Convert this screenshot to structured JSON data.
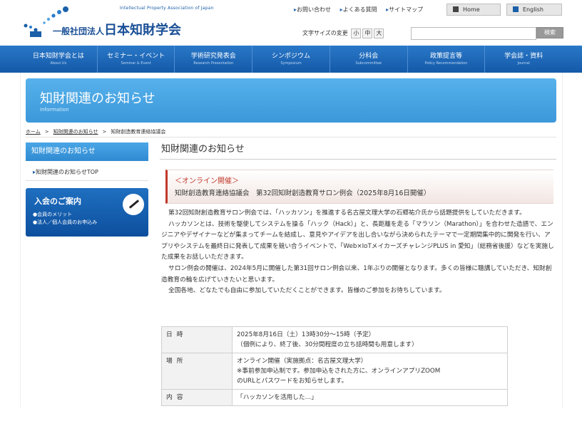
{
  "header": {
    "logo_en": "Intellectual Property Association of Japan",
    "logo_prefix": "一般社団法人",
    "logo_name": "日本知財学会",
    "top_links": [
      "お問い合わせ",
      "よくある質問",
      "サイトマップ"
    ],
    "home_button": "Home",
    "english_button": "English",
    "font_size_label": "文字サイズの変更",
    "font_sizes": [
      "小",
      "中",
      "大"
    ],
    "search_placeholder": "",
    "search_button": "検索"
  },
  "nav": [
    {
      "label": "日本知財学会とは",
      "en": "About Us"
    },
    {
      "label": "セミナー・イベント",
      "en": "Seminar & Event"
    },
    {
      "label": "学術研究発表会",
      "en": "Research Presentation"
    },
    {
      "label": "シンポジウム",
      "en": "Symposium"
    },
    {
      "label": "分科会",
      "en": "Subcommittee"
    },
    {
      "label": "政策提言等",
      "en": "Policy Recommendation"
    },
    {
      "label": "学会誌・資料",
      "en": "Journal"
    }
  ],
  "banner": {
    "title": "知財関連のお知らせ",
    "subtitle": "Information"
  },
  "breadcrumb": {
    "home": "ホーム",
    "parent": "知財関連のお知らせ",
    "current": "知財創造教育連絡協議会"
  },
  "sidebar": {
    "heading": "知財関連のお知らせ",
    "link": "知財関連のお知らせTOP",
    "join_title": "入会のご案内",
    "join_items": [
      "会員のメリット",
      "法人／個人会員のお申込み"
    ]
  },
  "main": {
    "title": "知財関連のお知らせ",
    "tag": "＜オンライン開催＞",
    "notice_title": "知財創造教育連絡協議会　第32回知財創造教育サロン例会（2025年8月16日開催）",
    "paragraphs": [
      "第32回知財創造教育サロン例会では、「ハッカソン」を推進する名古屋文理大学の石郷祐介氏から話題提供をしていただきます。",
      "ハッカソンとは、技術を駆使してシステムを操る「ハック（Hack）」と、長距離を走る「マラソン（Marathon）」を合わせた造語で、エンジニアやデザイナーなどが集まってチームを結成し、意見やアイデアを出し合いながら決められたテーマで一定期間集中的に開発を行い、アプリやシステムを最終日に発表して成果を競い合うイベントで、「Web×IoTメイカーズチャレンジPLUS in 愛知」（総務省後援）などを実施した成果をお話しいただきます。",
      "サロン例会の開催は、2024年5月に開催した第31回サロン例会以来、1年ぶりの開催となります。多くの皆様に聴講していただき、知財創造教育の輪を広げていきたいと思います。",
      "全国各地、どなたでも自由に参加していただくことができます。皆様のご参加をお待ちしています。"
    ],
    "info": [
      {
        "key": "日時",
        "lines": [
          "2025年8月16日（土）13時30分～15時（予定）",
          "（個例により、終了後、30分間程度の立ち話時間も用意します）"
        ]
      },
      {
        "key": "場所",
        "lines": [
          "オンライン開催（実施拠点：名古屋文理大学）",
          "※事前参加申込制です。参加申込をされた方に、オンラインアプリZOOM",
          "のURLとパスワードをお知らせします。"
        ]
      },
      {
        "key": "内容",
        "lines": [
          "「ハッカソンを活用した…」"
        ]
      }
    ]
  }
}
